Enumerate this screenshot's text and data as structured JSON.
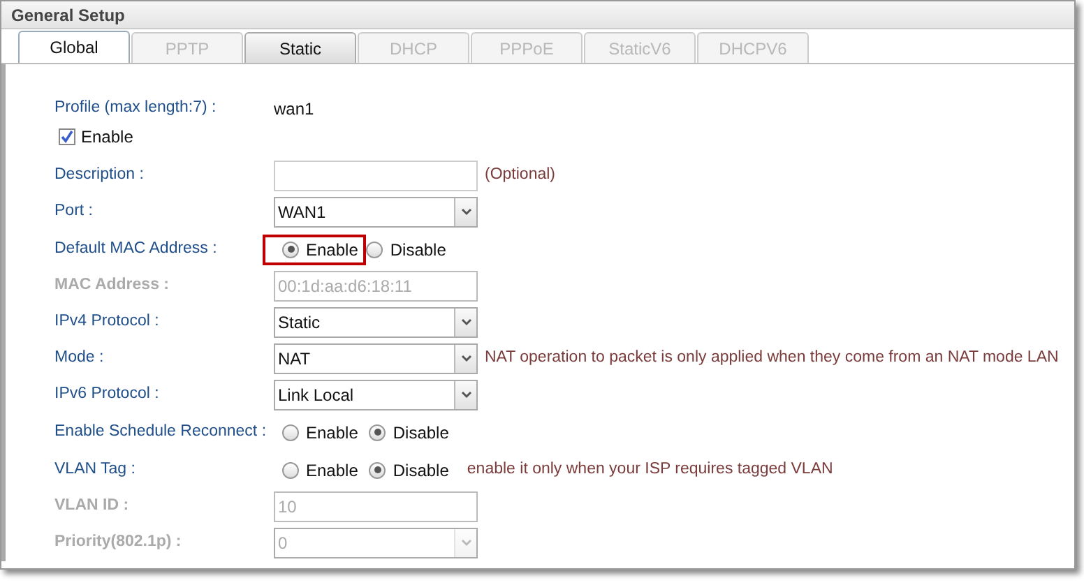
{
  "panel": {
    "title": "General Setup"
  },
  "tabs": [
    {
      "label": "Global",
      "selected": true,
      "disabled": false
    },
    {
      "label": "PPTP",
      "selected": false,
      "disabled": true
    },
    {
      "label": "Static",
      "selected": false,
      "disabled": false
    },
    {
      "label": "DHCP",
      "selected": false,
      "disabled": true
    },
    {
      "label": "PPPoE",
      "selected": false,
      "disabled": true
    },
    {
      "label": "StaticV6",
      "selected": false,
      "disabled": true
    },
    {
      "label": "DHCPV6",
      "selected": false,
      "disabled": true
    }
  ],
  "rows": [
    {
      "kind": "text",
      "label": "Profile (max length:7) :",
      "value": "wan1"
    },
    {
      "kind": "checkbox",
      "option": "Enable",
      "checked": true
    },
    {
      "kind": "input",
      "label": "Description :",
      "value": "",
      "disabled": false,
      "note": "(Optional)"
    },
    {
      "kind": "select",
      "label": "Port :",
      "value": "WAN1",
      "disabled": false
    },
    {
      "kind": "radio",
      "label": "Default MAC Address :",
      "options": [
        {
          "label": "Enable",
          "selected": true,
          "highlighted": true
        },
        {
          "label": "Disable",
          "selected": false,
          "highlighted": false
        }
      ]
    },
    {
      "kind": "input",
      "label": "MAC Address :",
      "value": "00:1d:aa:d6:18:11",
      "disabled": true
    },
    {
      "kind": "select",
      "label": "IPv4 Protocol :",
      "value": "Static",
      "disabled": false
    },
    {
      "kind": "select",
      "label": "Mode :",
      "value": "NAT",
      "disabled": false,
      "note": "NAT operation to packet is only applied when they come from an NAT mode LAN"
    },
    {
      "kind": "select",
      "label": "IPv6 Protocol :",
      "value": "Link Local",
      "disabled": false
    },
    {
      "kind": "radio",
      "label": "Enable Schedule Reconnect :",
      "options": [
        {
          "label": "Enable",
          "selected": false,
          "highlighted": false
        },
        {
          "label": "Disable",
          "selected": true,
          "highlighted": false
        }
      ]
    },
    {
      "kind": "radio",
      "label": "VLAN Tag :",
      "note": "enable it only when your ISP requires tagged VLAN",
      "options": [
        {
          "label": "Enable",
          "selected": false,
          "highlighted": false
        },
        {
          "label": "Disable",
          "selected": true,
          "highlighted": false
        }
      ]
    },
    {
      "kind": "input",
      "label": "VLAN ID :",
      "value": "10",
      "disabled": true
    },
    {
      "kind": "select",
      "label": "Priority(802.1p) :",
      "value": "0",
      "disabled": true
    }
  ]
}
